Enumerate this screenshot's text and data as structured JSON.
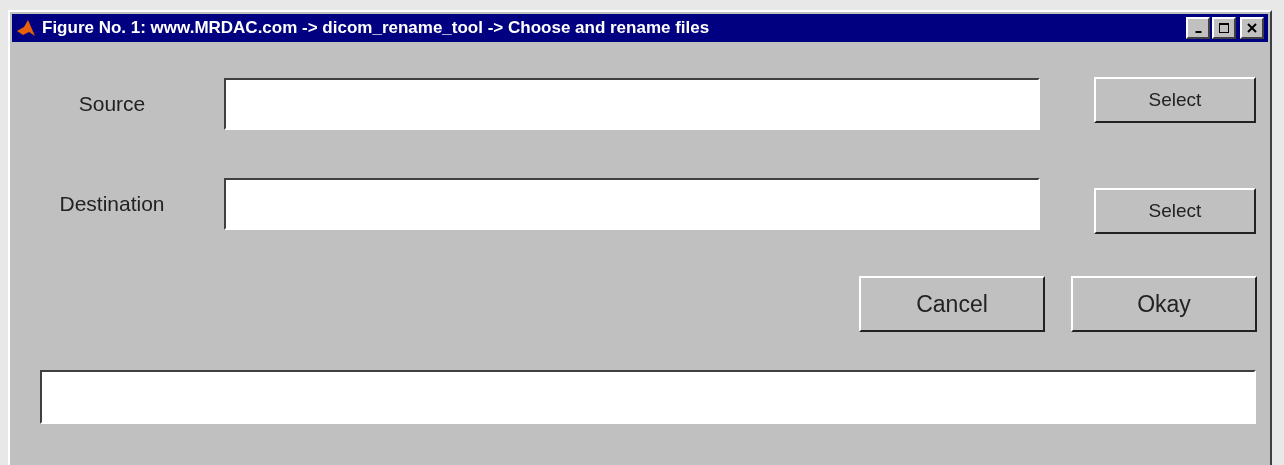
{
  "window": {
    "title": "Figure No. 1: www.MRDAC.com -> dicom_rename_tool -> Choose and rename files"
  },
  "rows": [
    {
      "label": "Source",
      "button": "Select"
    },
    {
      "label": "Destination",
      "button": "Select"
    }
  ],
  "actions": [
    "Cancel",
    "Okay"
  ]
}
